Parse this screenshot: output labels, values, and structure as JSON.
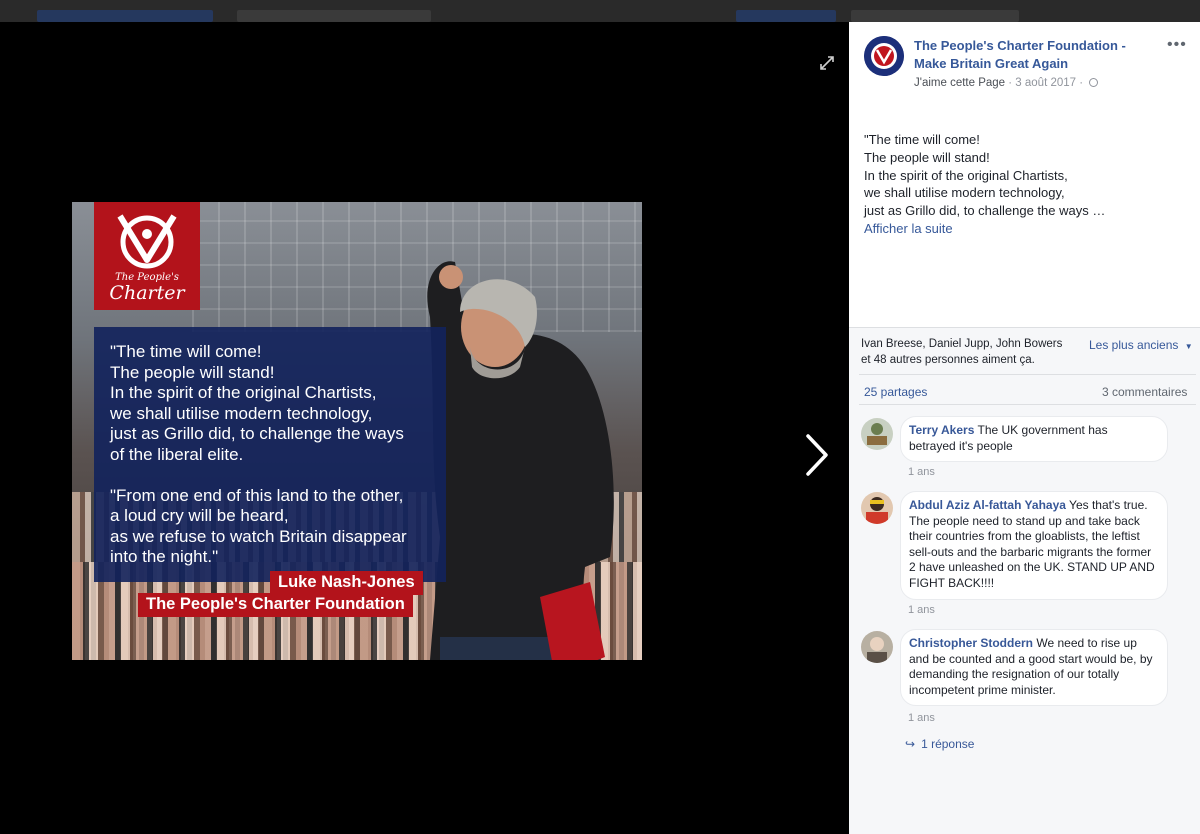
{
  "photo": {
    "logo_small": "The People's",
    "logo_big": "Charter",
    "quote_lines_1": [
      "\"The time will come!",
      "The people will stand!",
      "In the spirit of the original Chartists,",
      "we shall utilise modern technology,",
      "just as Grillo did, to challenge the ways",
      "of the liberal elite."
    ],
    "quote_lines_2": [
      "\"From one end of this land to the other,",
      "a loud cry will be heard,",
      "as we refuse to watch Britain disappear",
      "into the night.\""
    ],
    "signature_name": "Luke Nash-Jones",
    "signature_org": "The People's Charter Foundation"
  },
  "post": {
    "page_name": "The People's Charter Foundation - Make Britain Great Again",
    "like_page": "J'aime cette Page",
    "date": "3 août 2017",
    "separator": " · ",
    "text_lines": [
      "\"The time will come!",
      "The people will stand!",
      "In the spirit of the original Chartists,",
      "we shall utilise modern technology,",
      "just as Grillo did, to challenge the ways …"
    ],
    "see_more": "Afficher la suite",
    "more_icon": "ellipsis-icon"
  },
  "reactions": {
    "likers_line1": "Ivan Breese, Daniel Jupp, John Bowers",
    "likers_line2": "et 48 autres personnes aiment ça.",
    "order": "Les plus anciens",
    "shares": "25 partages",
    "comments_count": "3 commentaires"
  },
  "comments": [
    {
      "author": "Terry Akers",
      "text": "The UK government has betrayed it's people",
      "time": "1 ans"
    },
    {
      "author": "Abdul Aziz Al-fattah Yahaya",
      "text": "Yes that's true. The people need to stand up and take back their countries from the gloablists, the leftist sell-outs and the barbaric migrants the former 2 have unleashed on the UK. STAND UP AND FIGHT BACK!!!!",
      "time": "1 ans"
    },
    {
      "author": "Christopher Stoddern",
      "text": "We need to rise up and be counted and a good start would be, by demanding the resignation of our totally incompetent prime minister.",
      "time": "1 ans"
    }
  ],
  "reply_link": "1 réponse",
  "colors": {
    "link": "#365899",
    "brand_red": "#b3131b",
    "brand_blue": "#12225c"
  }
}
